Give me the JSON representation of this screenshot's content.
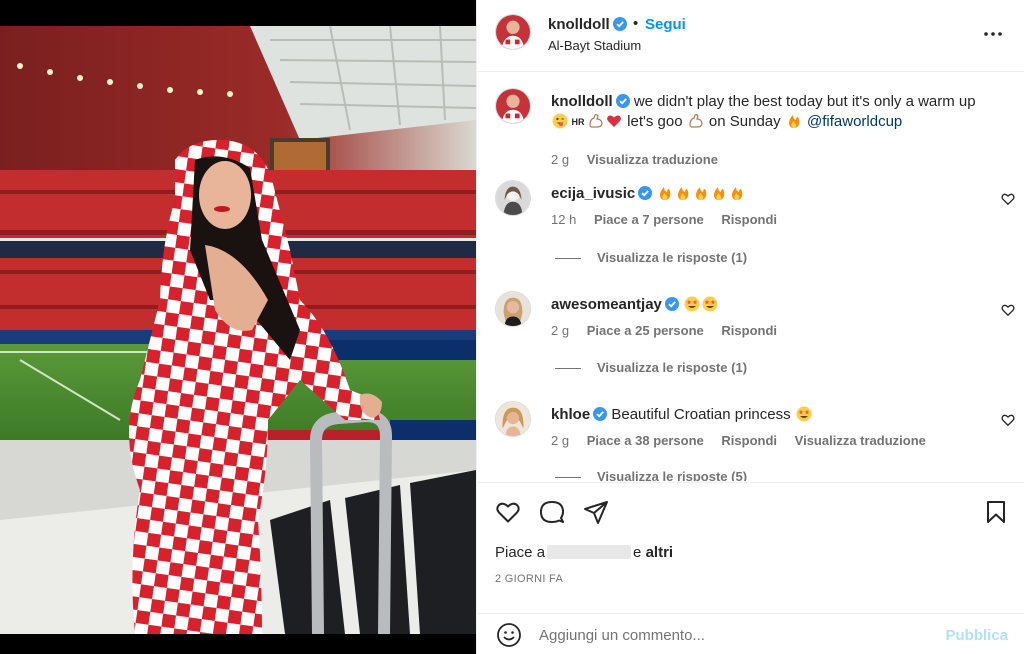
{
  "post": {
    "owner": "knolldoll",
    "follow_label": "Segui",
    "separator": "•",
    "location": "Al-Bayt Stadium",
    "more_icon": "more-horizontal-icon"
  },
  "caption": {
    "username": "knolldoll",
    "text_part1": "we didn't play the best today but it's only a warm up",
    "emoji_seq1": [
      "winking-tongue-face",
      "hr-flag",
      "flexed-biceps",
      "red-heart"
    ],
    "text_part2": "let's goo",
    "emoji_seq2": [
      "flexed-biceps"
    ],
    "text_part3": "on Sunday",
    "emoji_seq3": [
      "fire"
    ],
    "mention": "@fifaworldcup",
    "time": "2 g",
    "translate": "Visualizza traduzione"
  },
  "comments": [
    {
      "username": "ecija_ivusic",
      "verified": true,
      "emojis": [
        "fire",
        "fire",
        "fire",
        "fire",
        "fire"
      ],
      "text": "",
      "time": "12 h",
      "likes": "Piace a 7 persone",
      "reply": "Rispondi",
      "translate": "",
      "view_replies": "Visualizza le risposte (1)"
    },
    {
      "username": "awesomeantjay",
      "verified": true,
      "emojis": [
        "star-struck",
        "star-struck"
      ],
      "text": "",
      "time": "2 g",
      "likes": "Piace a 25 persone",
      "reply": "Rispondi",
      "translate": "",
      "view_replies": "Visualizza le risposte (1)"
    },
    {
      "username": "khloe",
      "verified": true,
      "emojis": [
        "star-struck"
      ],
      "text": "Beautiful Croatian princess",
      "time": "2 g",
      "likes": "Piace a 38 persone",
      "reply": "Rispondi",
      "translate": "Visualizza traduzione",
      "view_replies": "Visualizza le risposte (5)"
    }
  ],
  "actions": {
    "like_icon": "heart-icon",
    "comment_icon": "comment-icon",
    "share_icon": "share-icon",
    "save_icon": "bookmark-icon"
  },
  "likes": {
    "prefix": "Piace a",
    "suffix": "e",
    "others": "altri"
  },
  "time_ago": "2 GIORNI FA",
  "add_comment": {
    "placeholder": "Aggiungi un commento...",
    "publish": "Pubblica"
  },
  "colors": {
    "accent": "#0095f6",
    "verified": "#3897f0",
    "publish_disabled": "#b2dffc",
    "secondary_text": "#737373"
  }
}
